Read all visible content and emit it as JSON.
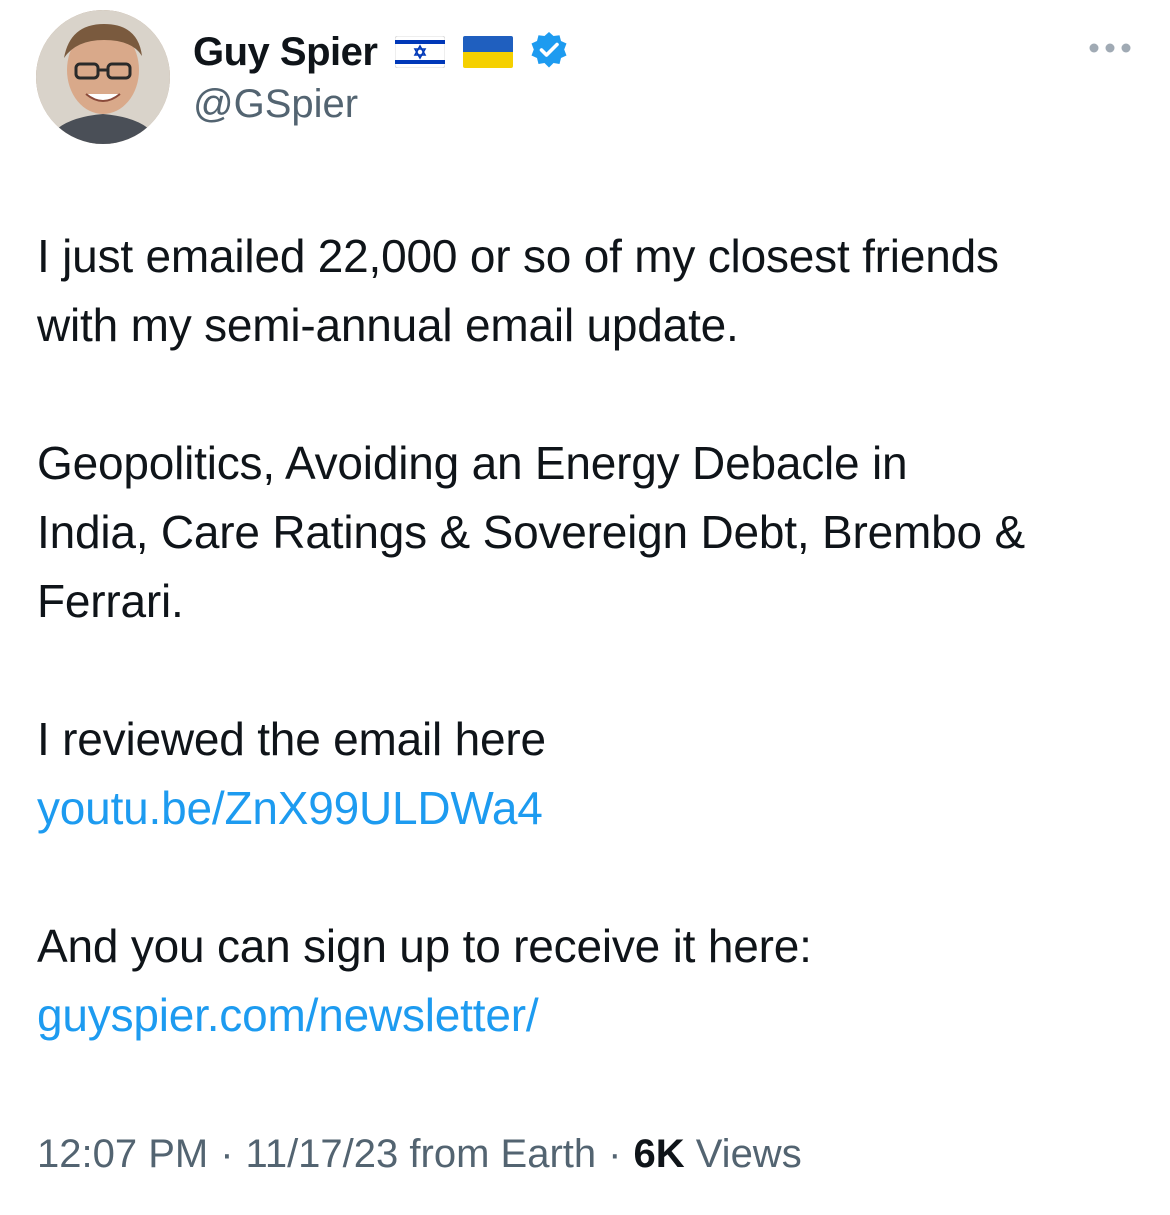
{
  "author": {
    "display_name": "Guy Spier",
    "handle": "@GSpier",
    "flags": [
      "israel-flag",
      "ukraine-flag"
    ],
    "verified": true,
    "verified_color": "#1d9bf0"
  },
  "tweet": {
    "paragraphs": [
      {
        "lines": [
          "I just emailed 22,000 or so of my closest friends",
          "with my semi-annual email update."
        ]
      },
      {
        "lines": [
          "Geopolitics, Avoiding an Energy Debacle in",
          "India, Care Ratings & Sovereign Debt, Brembo &",
          "Ferrari."
        ]
      },
      {
        "lines": [
          "I reviewed the email here"
        ],
        "link": "youtu.be/ZnX99ULDWa4"
      },
      {
        "lines": [
          "And you can sign up to receive it here:"
        ],
        "link": "guyspier.com/newsletter/"
      }
    ]
  },
  "meta": {
    "time": "12:07 PM",
    "date": "11/17/23",
    "source": "from Earth",
    "separator": "·",
    "views_count": "6K",
    "views_label": "Views"
  },
  "colors": {
    "text": "#0f1419",
    "secondary": "#536471",
    "link": "#1d9bf0"
  }
}
